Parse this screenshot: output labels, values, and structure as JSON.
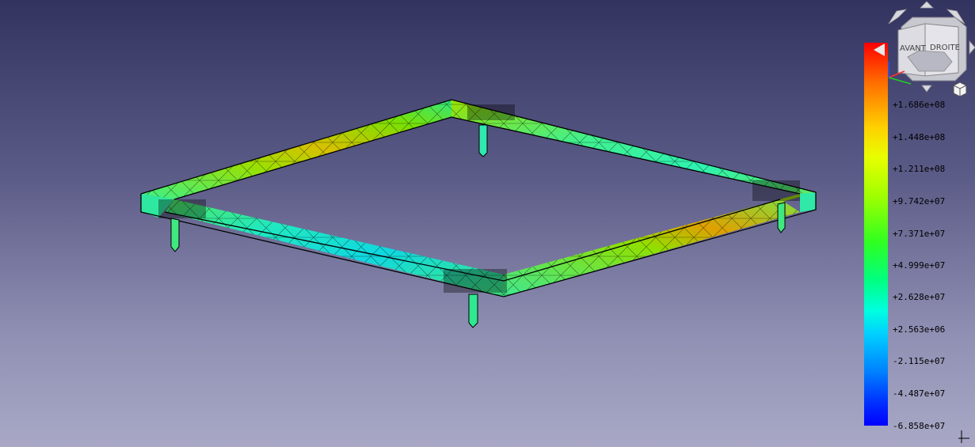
{
  "colors": {
    "background_top": "#33335f",
    "background_bottom": "#a8a8c6",
    "mesh_edge": "#000000",
    "colorbar_max": "#ff0000",
    "colorbar_min": "#0000ff"
  },
  "navigation_cube": {
    "front_face": "AVANT",
    "right_face": "DROITE",
    "arrow_icons": [
      "rotate-left-icon",
      "rotate-up-icon",
      "rotate-right-icon",
      "rotate-down-icon",
      "pan-right-icon"
    ],
    "menu_icon": "cube-menu-icon"
  },
  "colorbar": {
    "labels": [
      "+1.686e+08",
      "+1.448e+08",
      "+1.211e+08",
      "+9.742e+07",
      "+7.371e+07",
      "+4.999e+07",
      "+2.628e+07",
      "+2.563e+06",
      "-2.115e+07",
      "-4.487e+07",
      "-6.858e+07"
    ]
  }
}
